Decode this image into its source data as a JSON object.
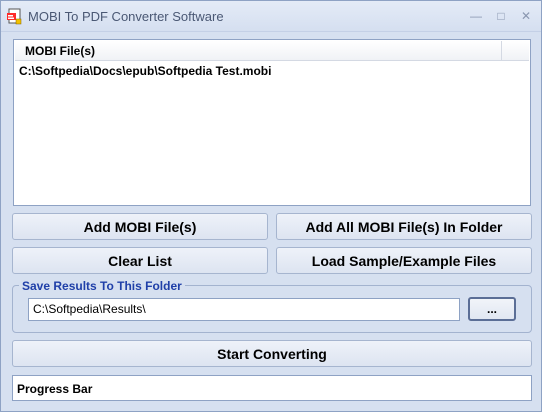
{
  "window": {
    "title": "MOBI To PDF Converter Software",
    "icon": "pdf-file-icon"
  },
  "file_list": {
    "column_header": "MOBI File(s)",
    "rows": [
      "C:\\Softpedia\\Docs\\epub\\Softpedia Test.mobi"
    ]
  },
  "buttons": {
    "add_files": "Add MOBI File(s)",
    "add_folder": "Add All MOBI File(s) In Folder",
    "clear_list": "Clear List",
    "load_sample": "Load Sample/Example Files",
    "start": "Start Converting",
    "browse": "..."
  },
  "output": {
    "group_label": "Save Results To This Folder",
    "path": "C:\\Softpedia\\Results\\"
  },
  "progress": {
    "label": "Progress Bar",
    "value": 0
  },
  "colors": {
    "window_bg": "#d6e0f0",
    "group_label": "#1f3fa8"
  }
}
